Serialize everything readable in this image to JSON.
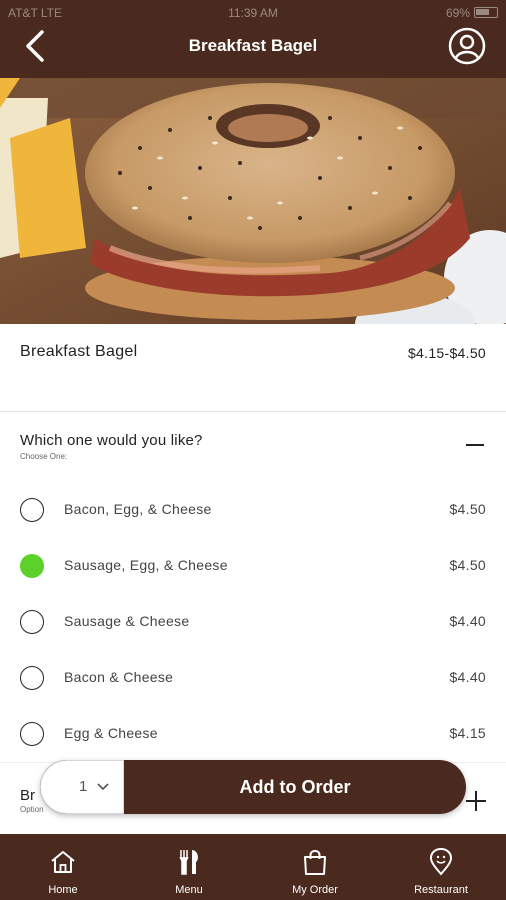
{
  "status_bar": {
    "carrier": "AT&T  LTE",
    "time": "11:39 AM",
    "battery": "69%"
  },
  "header": {
    "title": "Breakfast Bagel"
  },
  "product": {
    "name": "Breakfast Bagel",
    "price_range": "$4.15-$4.50"
  },
  "option_group": {
    "question": "Which one would you like?",
    "instruction": "Choose One:",
    "options": [
      {
        "label": "Bacon, Egg, & Cheese",
        "price": "$4.50",
        "selected": false
      },
      {
        "label": "Sausage, Egg, & Cheese",
        "price": "$4.50",
        "selected": true
      },
      {
        "label": "Sausage & Cheese",
        "price": "$4.40",
        "selected": false
      },
      {
        "label": "Bacon & Cheese",
        "price": "$4.40",
        "selected": false
      },
      {
        "label": "Egg & Cheese",
        "price": "$4.15",
        "selected": false
      }
    ]
  },
  "next_group": {
    "label": "Br",
    "instruction": "Option"
  },
  "order_bar": {
    "quantity": "1",
    "add_label": "Add to Order"
  },
  "tabs": [
    {
      "label": "Home",
      "icon": "home-icon"
    },
    {
      "label": "Menu",
      "icon": "fork-knife-icon"
    },
    {
      "label": "My Order",
      "icon": "bag-icon"
    },
    {
      "label": "Restaurant",
      "icon": "location-pin-icon"
    }
  ],
  "colors": {
    "brand_brown": "#4a2a1e",
    "selected_green": "#5bd12a"
  }
}
